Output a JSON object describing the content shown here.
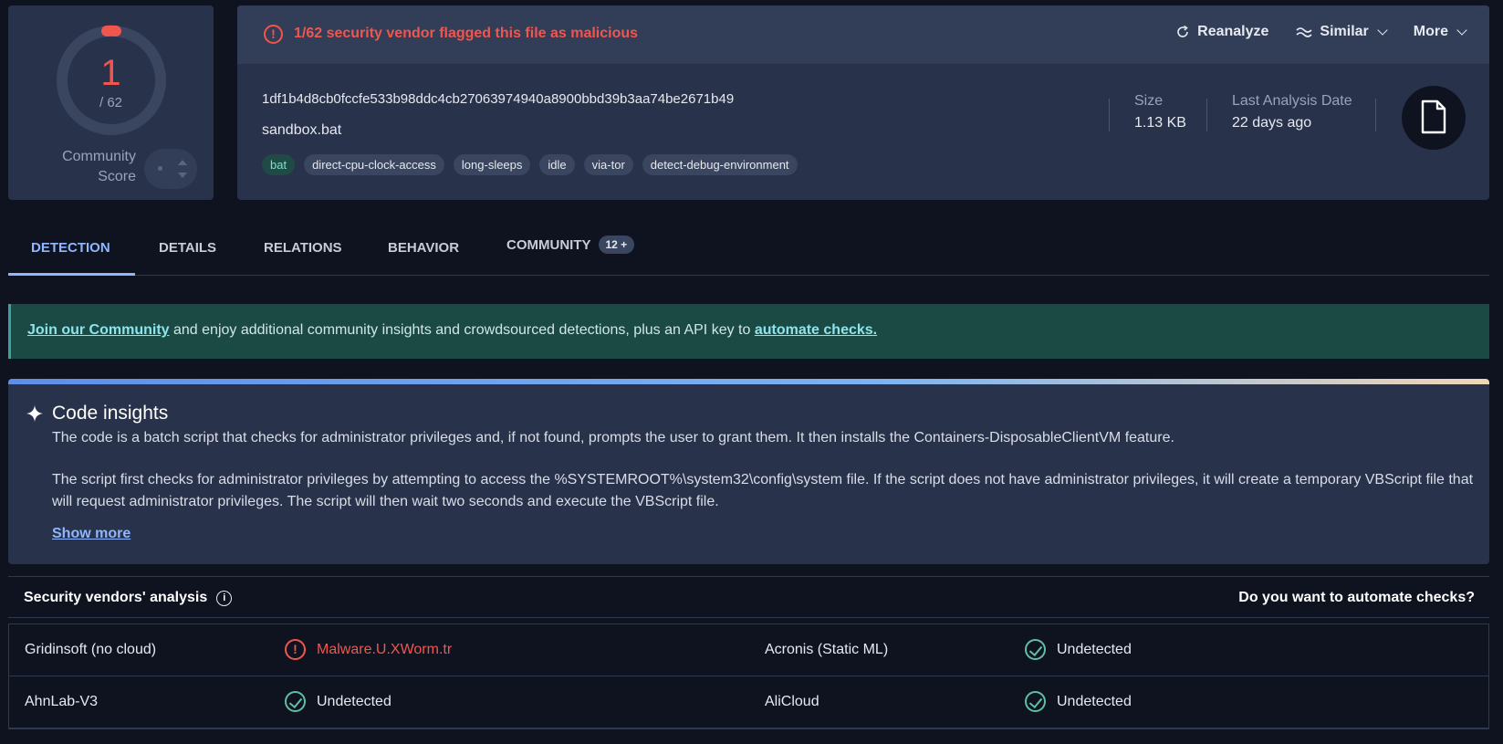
{
  "score": {
    "detections": "1",
    "total": "/ 62",
    "community_label_1": "Community",
    "community_label_2": "Score"
  },
  "file": {
    "alert": "1/62 security vendor flagged this file as malicious",
    "actions": {
      "reanalyze": "Reanalyze",
      "similar": "Similar",
      "more": "More"
    },
    "hash": "1df1b4d8cb0fccfe533b98ddc4cb27063974940a8900bbd39b3aa74be2671b49",
    "name": "sandbox.bat",
    "tags": [
      "bat",
      "direct-cpu-clock-access",
      "long-sleeps",
      "idle",
      "via-tor",
      "detect-debug-environment"
    ],
    "size_label": "Size",
    "size_value": "1.13 KB",
    "date_label": "Last Analysis Date",
    "date_value": "22 days ago"
  },
  "tabs": {
    "detection": "DETECTION",
    "details": "DETAILS",
    "relations": "RELATIONS",
    "behavior": "BEHAVIOR",
    "community": "COMMUNITY",
    "community_badge": "12 +"
  },
  "banner": {
    "link1": "Join our Community",
    "middle": " and enjoy additional community insights and crowdsourced detections, plus an API key to ",
    "link2": "automate checks."
  },
  "insights": {
    "title": "Code insights",
    "p1": "The code is a batch script that checks for administrator privileges and, if not found, prompts the user to grant them. It then installs the Containers-DisposableClientVM feature.",
    "p2": "The script first checks for administrator privileges by attempting to access the %SYSTEMROOT%\\system32\\config\\system file. If the script does not have administrator privileges, it will create a temporary VBScript file that will request administrator privileges. The script will then wait two seconds and execute the VBScript file.",
    "show_more": "Show more"
  },
  "vendors": {
    "title": "Security vendors' analysis",
    "automate": "Do you want to automate checks?",
    "rows": [
      {
        "left_name": "Gridinsoft (no cloud)",
        "left_result": "Malware.U.XWorm.tr",
        "right_name": "Acronis (Static ML)",
        "right_result": "Undetected"
      },
      {
        "left_name": "AhnLab-V3",
        "left_result": "Undetected",
        "right_name": "AliCloud",
        "right_result": "Undetected"
      }
    ]
  },
  "colors": {
    "malicious": "#f0564e",
    "undetected": "#5fbfa2",
    "accent": "#8fb6ff"
  }
}
